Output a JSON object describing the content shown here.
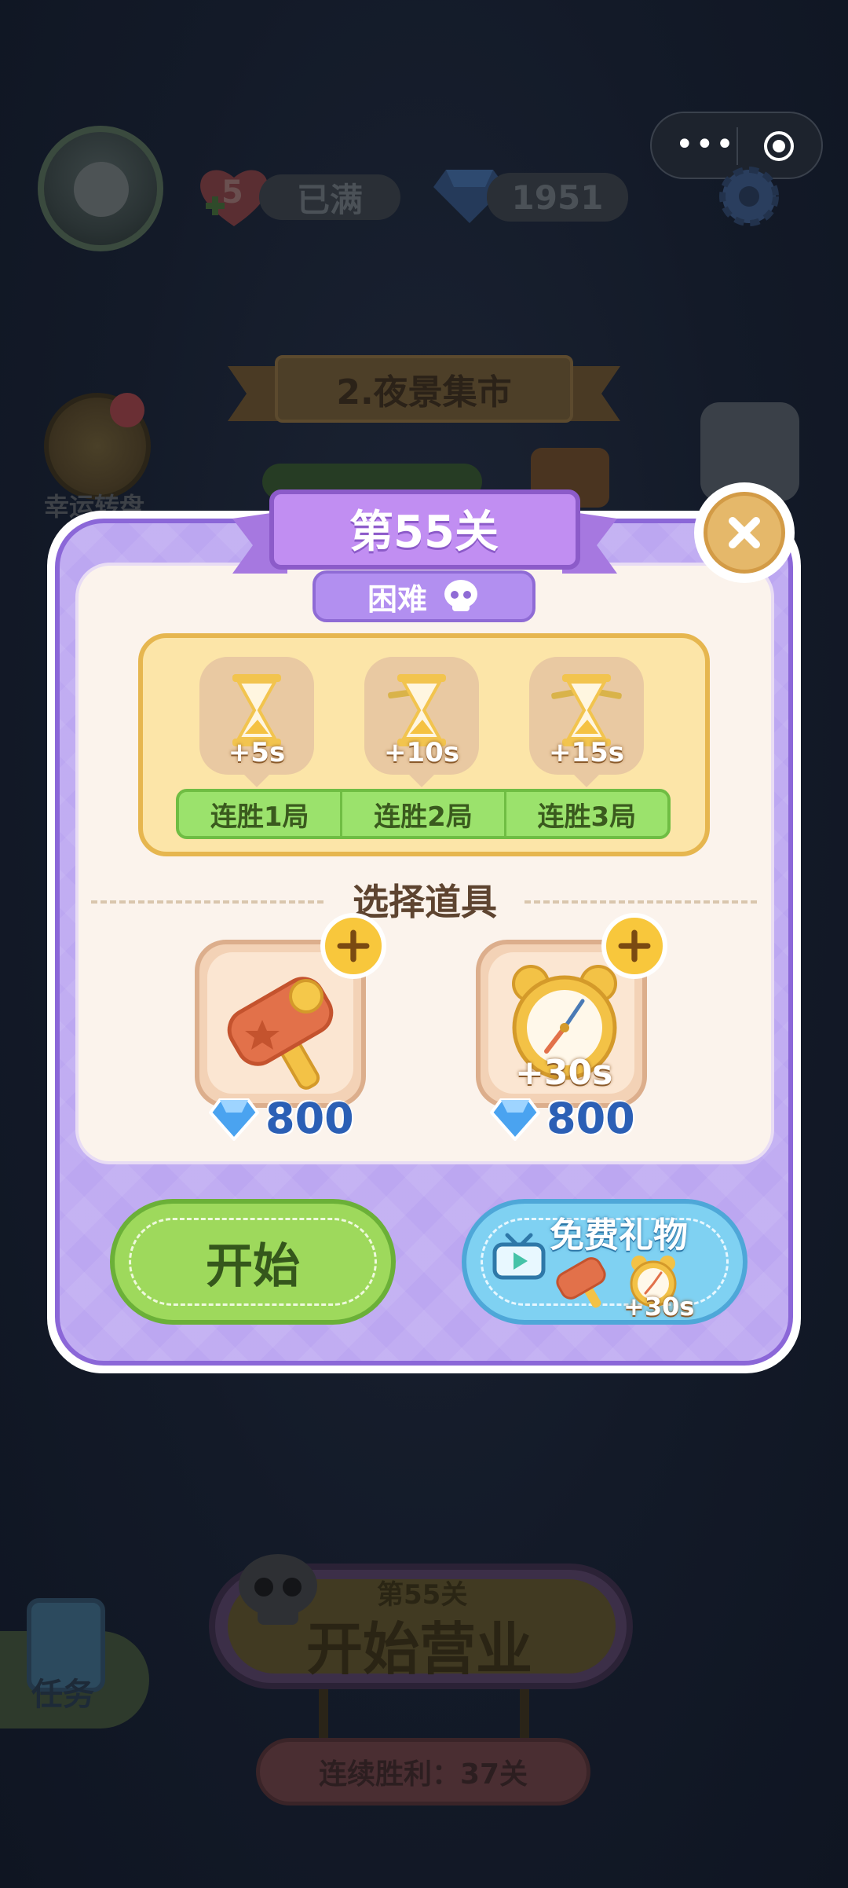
{
  "top_bar": {
    "hearts": "5",
    "hearts_status": "已满",
    "gems": "1951"
  },
  "background": {
    "level_name": "2.夜景集市",
    "lucky_wheel_label": "幸运转盘",
    "task_label": "任务",
    "start_business_level": "第55关",
    "start_business_label": "开始营业",
    "win_streak_label": "连续胜利：37关"
  },
  "modal": {
    "title": "第55关",
    "difficulty": "困难",
    "rewards": [
      {
        "amount": "+5s",
        "streak": "连胜1局"
      },
      {
        "amount": "+10s",
        "streak": "连胜2局"
      },
      {
        "amount": "+15s",
        "streak": "连胜3局"
      }
    ],
    "select_title": "选择道具",
    "tools": [
      {
        "icon": "hammer-icon",
        "overlay": "",
        "price": "800"
      },
      {
        "icon": "alarm-clock-icon",
        "overlay": "+30s",
        "price": "800"
      }
    ],
    "start_label": "开始",
    "gift_label": "免费礼物",
    "gift_time": "+30s"
  },
  "colors": {
    "modal_purple": "#bca7f1",
    "start_green": "#9ed95c",
    "gift_blue": "#7fd1f2",
    "gem_blue": "#2b5fb5"
  }
}
